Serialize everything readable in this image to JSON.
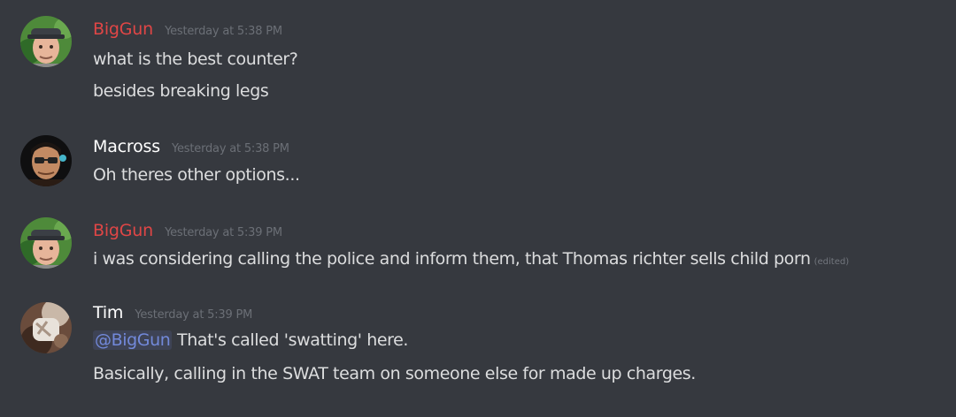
{
  "colors": {
    "background": "#36393f",
    "message_text": "#dcddde",
    "timestamp": "#6b6f76",
    "mention": "#7289da"
  },
  "messages": [
    {
      "author": "BigGun",
      "author_color": "#e04646",
      "avatar": "avatar-biggun",
      "timestamp": "Yesterday at 5:38 PM",
      "lines": [
        "what is the best counter?",
        "besides breaking legs"
      ]
    },
    {
      "author": "Macross",
      "author_color": "#ffffff",
      "avatar": "avatar-macross",
      "timestamp": "Yesterday at 5:38 PM",
      "lines": [
        "Oh theres other options..."
      ]
    },
    {
      "author": "BigGun",
      "author_color": "#e04646",
      "avatar": "avatar-biggun",
      "timestamp": "Yesterday at 5:39 PM",
      "lines": [
        "i was considering calling the police and inform them, that Thomas richter sells child porn"
      ],
      "edited_label": "(edited)"
    },
    {
      "author": "Tim",
      "author_color": "#ffffff",
      "avatar": "avatar-tim",
      "timestamp": "Yesterday at 5:39 PM",
      "mention": "@BigGun",
      "lines": [
        "That's called 'swatting' here.",
        "Basically, calling in the SWAT team on someone else for made up charges."
      ]
    }
  ]
}
